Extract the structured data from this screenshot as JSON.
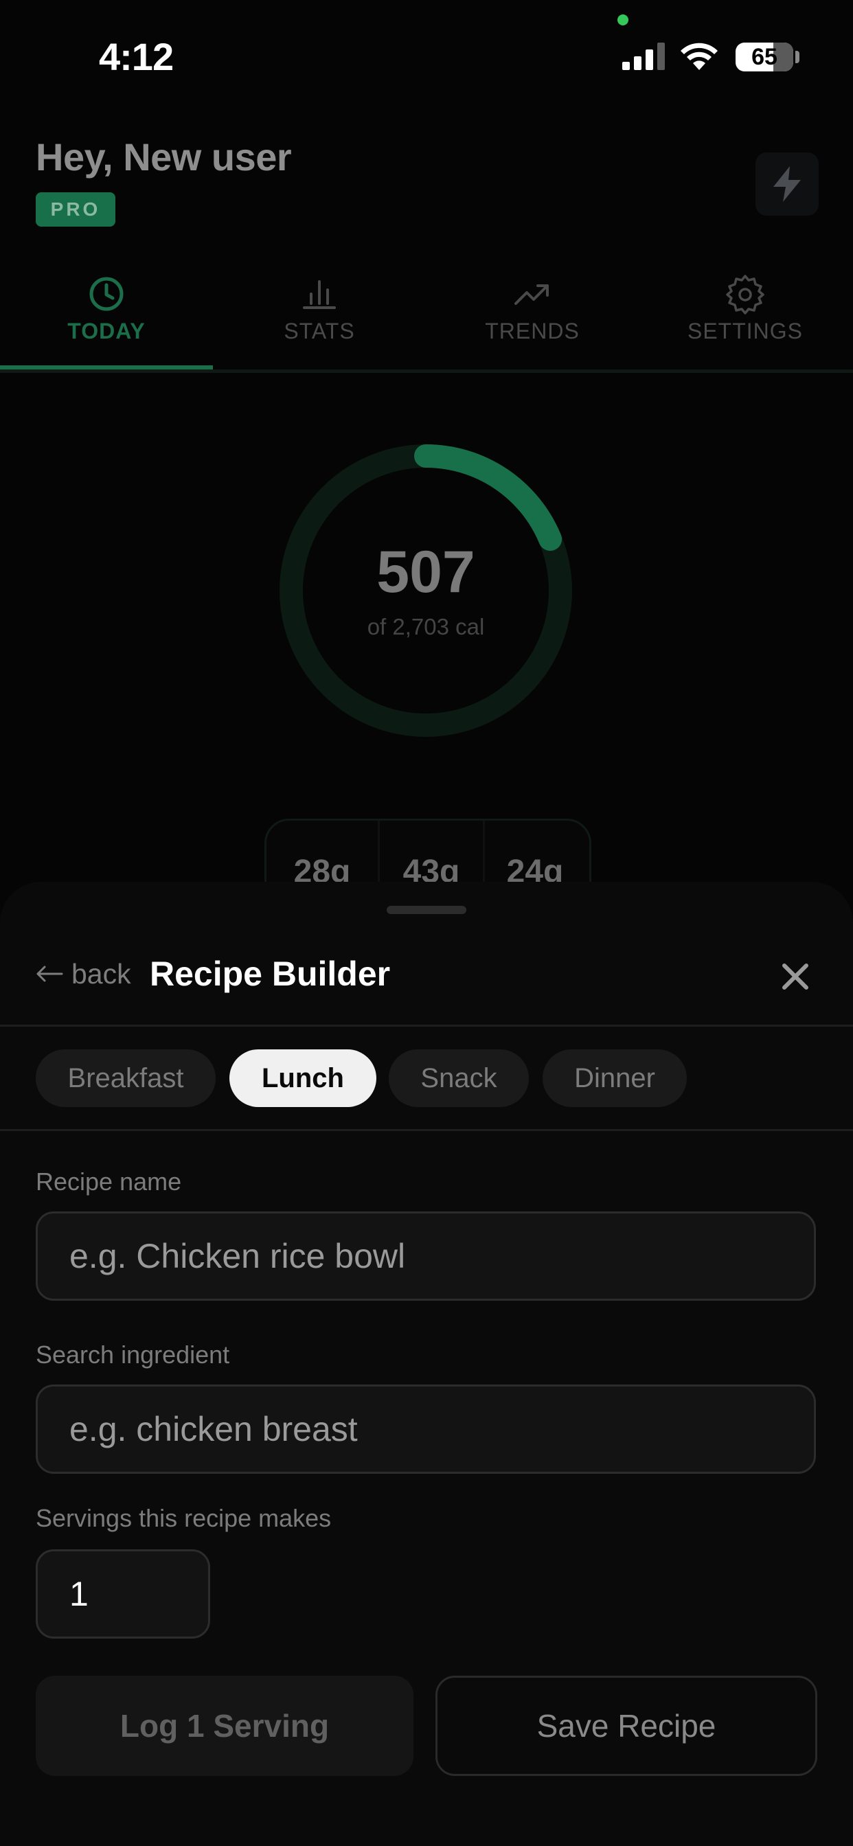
{
  "status_bar": {
    "time": "4:12",
    "battery_level": "65"
  },
  "header": {
    "greeting": "Hey, New user",
    "badge": "PRO",
    "action_icon": "bolt-icon"
  },
  "nav": {
    "tabs": [
      {
        "label": "TODAY",
        "icon": "clock-icon",
        "active": true
      },
      {
        "label": "STATS",
        "icon": "bar-chart-icon",
        "active": false
      },
      {
        "label": "TRENDS",
        "icon": "trend-up-icon",
        "active": false
      },
      {
        "label": "SETTINGS",
        "icon": "gear-icon",
        "active": false
      }
    ]
  },
  "calories": {
    "consumed": "507",
    "goal_text": "of 2,703 cal",
    "consumed_value": 507,
    "goal_value": 2703
  },
  "macros": [
    {
      "value": "28g"
    },
    {
      "value": "43g"
    },
    {
      "value": "24g"
    }
  ],
  "sheet": {
    "back_label": "back",
    "title": "Recipe Builder",
    "meal_types": [
      {
        "label": "Breakfast",
        "active": false
      },
      {
        "label": "Lunch",
        "active": true
      },
      {
        "label": "Snack",
        "active": false
      },
      {
        "label": "Dinner",
        "active": false
      }
    ],
    "recipe_name": {
      "label": "Recipe name",
      "placeholder": "e.g. Chicken rice bowl",
      "value": ""
    },
    "ingredient_search": {
      "label": "Search ingredient",
      "placeholder": "e.g. chicken breast",
      "value": ""
    },
    "servings": {
      "label": "Servings this recipe makes",
      "value": "1"
    },
    "log_button": "Log 1 Serving",
    "save_button": "Save Recipe"
  },
  "colors": {
    "accent": "#1c6e4b",
    "sheet_background": "#0a0a0a",
    "active_chip": "#f0f0f0"
  }
}
